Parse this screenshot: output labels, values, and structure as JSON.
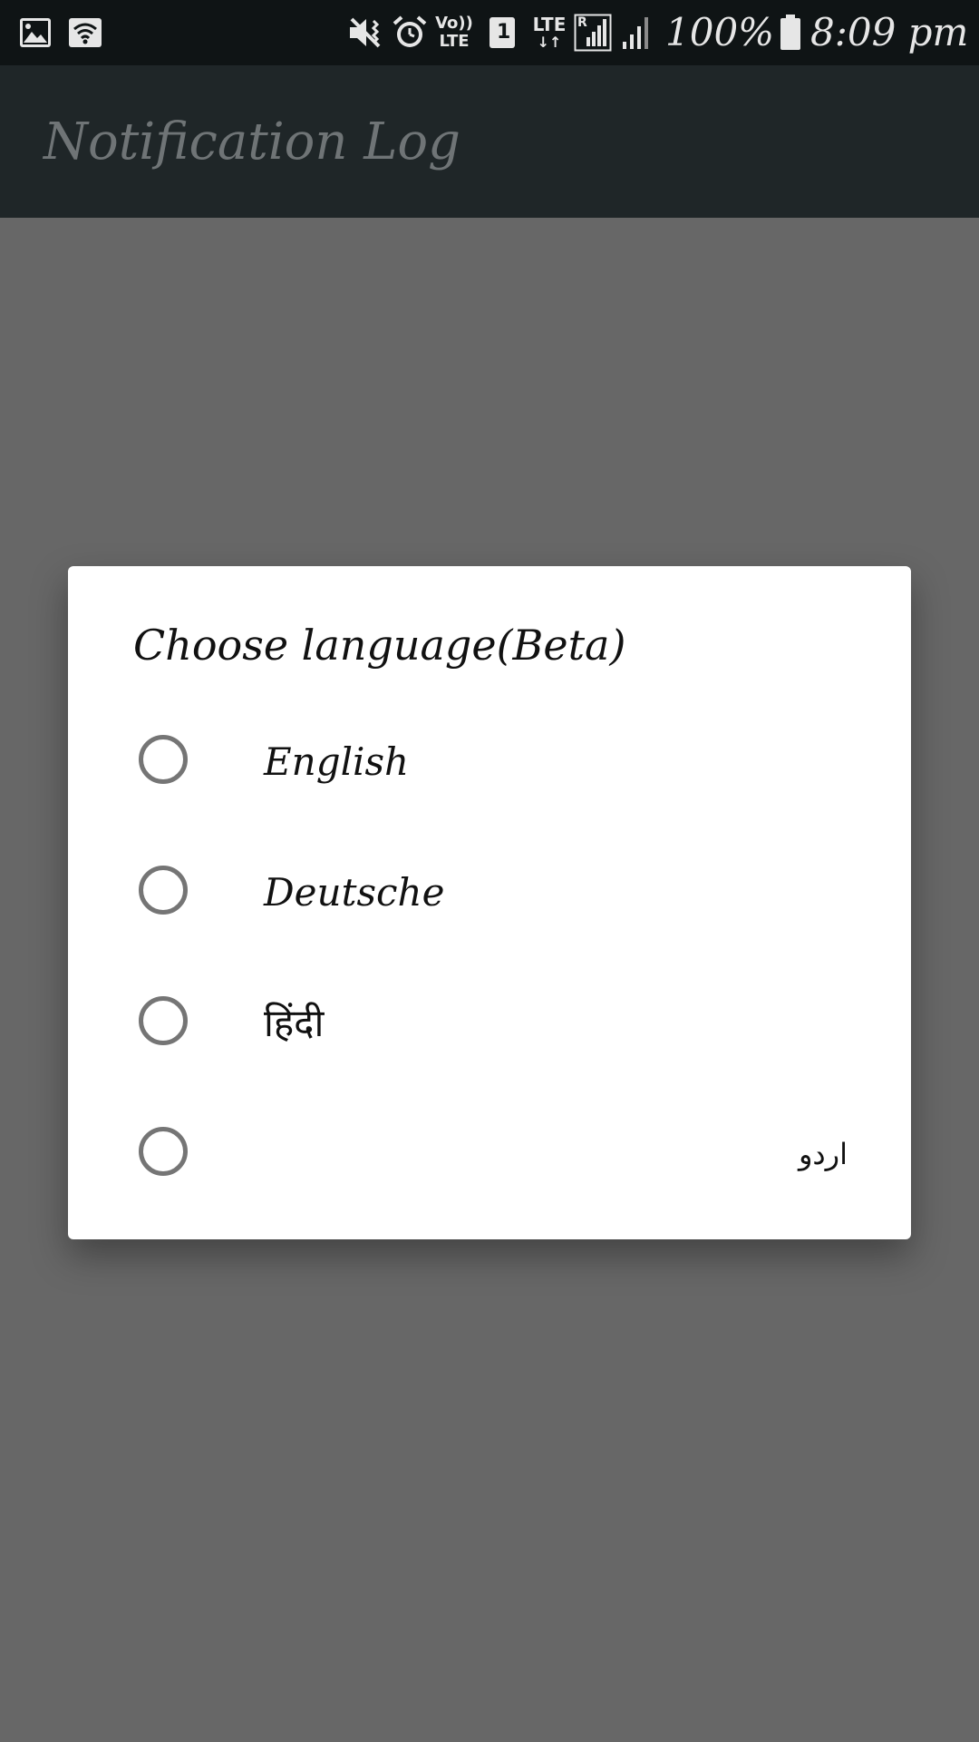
{
  "status_bar": {
    "icons": [
      "image-icon",
      "wifi-hotspot-icon",
      "vibrate-mute-icon",
      "alarm-icon",
      "volte-icon",
      "sim-1-icon",
      "lte-data-icon",
      "signal-roaming-icon",
      "signal-icon",
      "battery-icon"
    ],
    "volte_top": "Vo))",
    "volte_bottom": "LTE",
    "sim_number": "1",
    "lte_label": "LTE",
    "roaming_label": "R",
    "battery": "100%",
    "time": "8:09 pm"
  },
  "app_bar": {
    "title": "Notification Log"
  },
  "dialog": {
    "title": "Choose language(Beta)",
    "options": [
      {
        "label": "English",
        "selected": false
      },
      {
        "label": "Deutsche",
        "selected": false
      },
      {
        "label": "हिंदी",
        "selected": false
      },
      {
        "label": "اردو",
        "selected": false
      }
    ]
  },
  "colors": {
    "status_bar_bg": "#0f1415",
    "app_bar_bg": "#1f2628",
    "scrim_bg": "#676767",
    "dialog_bg": "#ffffff",
    "radio_outline": "#757575"
  }
}
